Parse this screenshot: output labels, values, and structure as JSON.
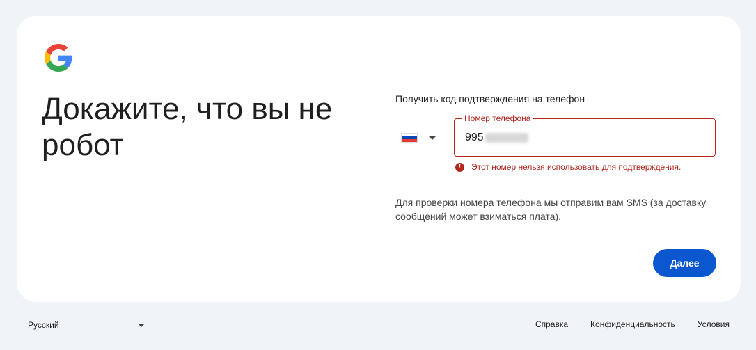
{
  "headline": "Докажите, что вы не робот",
  "instruction": "Получить код подтверждения на телефон",
  "country": {
    "flag": "russia-flag",
    "dropdown_icon": "chevron-down-icon"
  },
  "phone_field": {
    "label": "Номер телефона",
    "value_visible": "995",
    "value_masked": true
  },
  "error": {
    "icon": "error-icon",
    "text": "Этот номер нельзя использовать для подтверждения."
  },
  "sms_note": "Для проверки номера телефона мы отправим вам SMS (за доставку сообщений может взиматься плата).",
  "next_button": "Далее",
  "footer": {
    "language": "Русский",
    "links": [
      "Справка",
      "Конфиденциальность",
      "Условия"
    ]
  },
  "colors": {
    "background": "#f0f4f9",
    "card": "#ffffff",
    "primary": "#0b57d0",
    "error": "#b3261e"
  }
}
